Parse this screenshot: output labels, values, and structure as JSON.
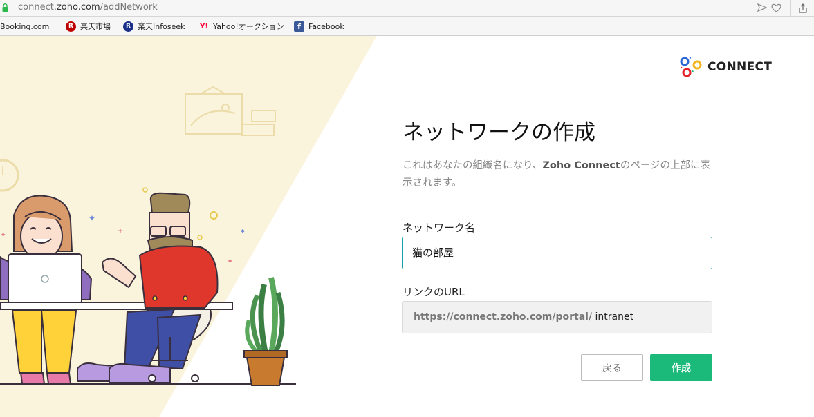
{
  "browser": {
    "url_prefix": "connect.",
    "url_domain": "zoho.com",
    "url_path": "/addNetwork",
    "bookmarks": [
      {
        "label": "Booking.com",
        "icon": "booking-icon"
      },
      {
        "label": "楽天市場",
        "icon": "rakuten-icon",
        "letter": "R",
        "color": "#bf0000"
      },
      {
        "label": "楽天Infoseek",
        "icon": "infoseek-icon",
        "letter": "R",
        "color": "#1a2f8a"
      },
      {
        "label": "Yahoo!オークション",
        "icon": "yahoo-icon",
        "letter": "Y!",
        "color": "#ff0033"
      },
      {
        "label": "Facebook",
        "icon": "facebook-icon",
        "letter": "f",
        "color": "#3b5998"
      }
    ]
  },
  "logo": {
    "text": "CONNECT"
  },
  "form": {
    "title": "ネットワークの作成",
    "description_before": "これはあなたの組織名になり、",
    "description_brand": "Zoho Connect",
    "description_after": "のページの上部に表示されます。",
    "network_name_label": "ネットワーク名",
    "network_name_value": "猫の部屋",
    "url_label": "リンクのURL",
    "url_prefix": "https://connect.zoho.com/portal/",
    "url_slug": "intranet",
    "back_label": "戻る",
    "create_label": "作成"
  },
  "colors": {
    "accent": "#1a9ea8",
    "create_button": "#1cba7a",
    "illustration_bg": "#fbf4dc"
  }
}
